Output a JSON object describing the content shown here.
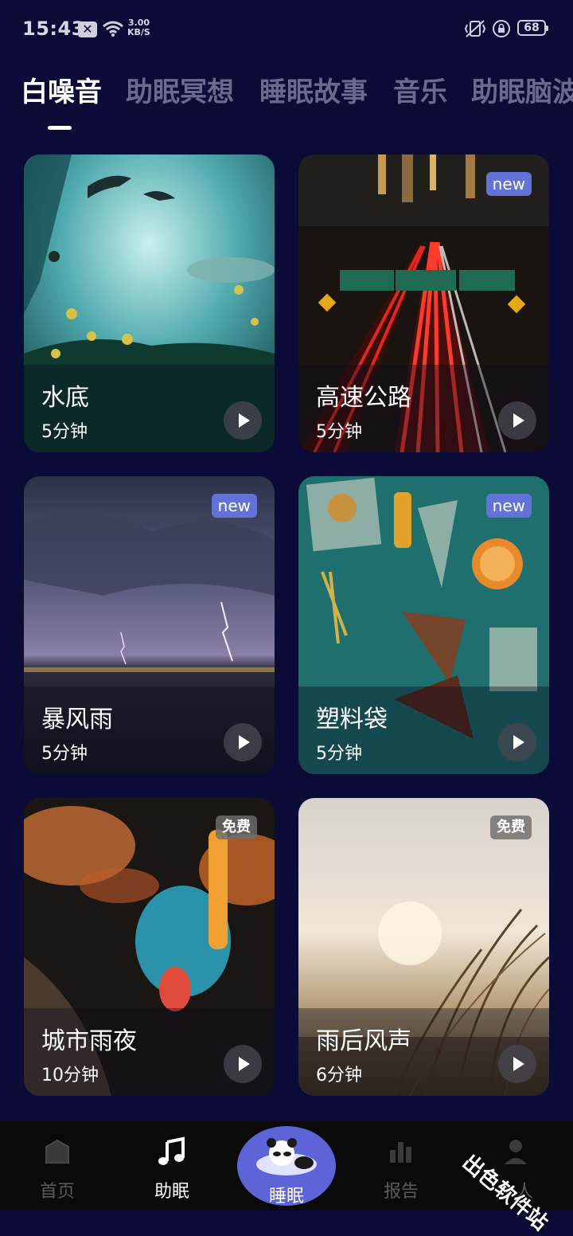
{
  "status_bar": {
    "time": "15:43",
    "net_speed_value": "3.00",
    "net_speed_unit": "KB/S",
    "battery": "68"
  },
  "tabs": [
    {
      "label": "白噪音",
      "active": true
    },
    {
      "label": "助眠冥想",
      "active": false
    },
    {
      "label": "睡眠故事",
      "active": false
    },
    {
      "label": "音乐",
      "active": false
    },
    {
      "label": "助眠脑波",
      "active": false
    }
  ],
  "cards": [
    {
      "title": "水底",
      "duration": "5分钟",
      "badge": ""
    },
    {
      "title": "高速公路",
      "duration": "5分钟",
      "badge": "new"
    },
    {
      "title": "暴风雨",
      "duration": "5分钟",
      "badge": "new"
    },
    {
      "title": "塑料袋",
      "duration": "5分钟",
      "badge": "new"
    },
    {
      "title": "城市雨夜",
      "duration": "10分钟",
      "badge": "免费"
    },
    {
      "title": "雨后风声",
      "duration": "6分钟",
      "badge": "免费"
    }
  ],
  "nav": {
    "home": "首页",
    "sleep_aid": "助眠",
    "sleep": "睡眠",
    "report": "报告",
    "profile": "个人"
  },
  "watermark": "出色软件站",
  "colors": {
    "background": "#0b0b38",
    "accent": "#5c64d8",
    "new_badge": "#6272d6"
  }
}
